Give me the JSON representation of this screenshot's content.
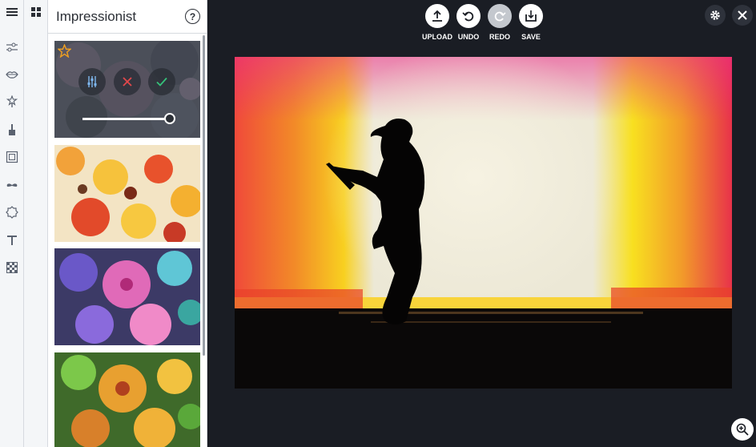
{
  "panel": {
    "title": "Impressionist",
    "help_icon_text": "?"
  },
  "toolbar": {
    "upload_label": "UPLOAD",
    "undo_label": "UNDO",
    "redo_label": "REDO",
    "save_label": "SAVE"
  },
  "rail_tools": [
    "menu-icon",
    "sliders-icon",
    "lips-icon",
    "wand-icon",
    "brush-icon",
    "frame-icon",
    "mustache-icon",
    "badge-icon",
    "text-icon",
    "texture-icon"
  ],
  "effect_thumbnails": [
    "impressionist-selected",
    "impressionist-warm",
    "impressionist-cool",
    "impressionist-green"
  ],
  "active_effect_strength": 1.0,
  "colors": {
    "accent": "#2b2f36",
    "background": "#1a1d24",
    "check": "#35c27a",
    "cancel": "#e2474b",
    "star": "#f0a020"
  }
}
